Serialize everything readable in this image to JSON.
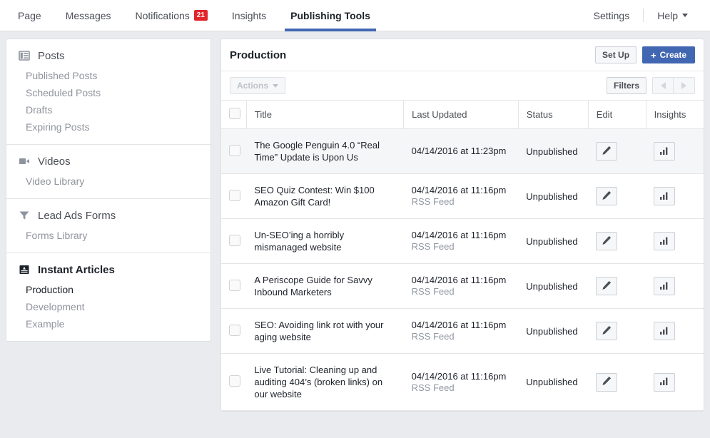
{
  "topnav": {
    "left_items": [
      {
        "label": "Page",
        "badge": null,
        "active": false
      },
      {
        "label": "Messages",
        "badge": null,
        "active": false
      },
      {
        "label": "Notifications",
        "badge": "21",
        "active": false
      },
      {
        "label": "Insights",
        "badge": null,
        "active": false
      },
      {
        "label": "Publishing Tools",
        "badge": null,
        "active": true
      }
    ],
    "right_items": [
      {
        "label": "Settings",
        "caret": false
      },
      {
        "label": "Help",
        "caret": true
      }
    ],
    "badge_color": "#e1252b",
    "active_underline_color": "#4267b2"
  },
  "sidebar": {
    "groups": [
      {
        "icon": "posts-icon",
        "title": "Posts",
        "current": false,
        "links": [
          {
            "label": "Published Posts",
            "current": false
          },
          {
            "label": "Scheduled Posts",
            "current": false
          },
          {
            "label": "Drafts",
            "current": false
          },
          {
            "label": "Expiring Posts",
            "current": false
          }
        ]
      },
      {
        "icon": "video-icon",
        "title": "Videos",
        "current": false,
        "links": [
          {
            "label": "Video Library",
            "current": false
          }
        ]
      },
      {
        "icon": "funnel-icon",
        "title": "Lead Ads Forms",
        "current": false,
        "links": [
          {
            "label": "Forms Library",
            "current": false
          }
        ]
      },
      {
        "icon": "instant-articles-icon",
        "title": "Instant Articles",
        "current": true,
        "links": [
          {
            "label": "Production",
            "current": true
          },
          {
            "label": "Development",
            "current": false
          },
          {
            "label": "Example",
            "current": false
          }
        ]
      }
    ]
  },
  "main": {
    "title": "Production",
    "setup_label": "Set Up",
    "create_label": "Create",
    "create_plus": "+",
    "actions_label": "Actions",
    "filters_label": "Filters",
    "create_button_color": "#4267b2",
    "columns": [
      "",
      "Title",
      "Last Updated",
      "Status",
      "Edit",
      "Insights"
    ],
    "rows": [
      {
        "title": "The Google Penguin 4.0 “Real Time” Update is Upon Us",
        "last_updated": "04/14/2016 at 11:23pm",
        "source": "",
        "status": "Unpublished",
        "edit_icon": "pencil-icon",
        "insights_icon": "bar-chart-icon",
        "highlighted": true
      },
      {
        "title": "SEO Quiz Contest: Win $100 Amazon Gift Card!",
        "last_updated": "04/14/2016 at 11:16pm",
        "source": "RSS Feed",
        "status": "Unpublished",
        "edit_icon": "pencil-icon",
        "insights_icon": "bar-chart-icon",
        "highlighted": false
      },
      {
        "title": "Un-SEO’ing a horribly mismanaged website",
        "last_updated": "04/14/2016 at 11:16pm",
        "source": "RSS Feed",
        "status": "Unpublished",
        "edit_icon": "pencil-icon",
        "insights_icon": "bar-chart-icon",
        "highlighted": false
      },
      {
        "title": "A Periscope Guide for Savvy Inbound Marketers",
        "last_updated": "04/14/2016 at 11:16pm",
        "source": "RSS Feed",
        "status": "Unpublished",
        "edit_icon": "pencil-icon",
        "insights_icon": "bar-chart-icon",
        "highlighted": false
      },
      {
        "title": "SEO: Avoiding link rot with your aging website",
        "last_updated": "04/14/2016 at 11:16pm",
        "source": "RSS Feed",
        "status": "Unpublished",
        "edit_icon": "pencil-icon",
        "insights_icon": "bar-chart-icon",
        "highlighted": false
      },
      {
        "title": "Live Tutorial: Cleaning up and auditing 404’s (broken links) on our website",
        "last_updated": "04/14/2016 at 11:16pm",
        "source": "RSS Feed",
        "status": "Unpublished",
        "edit_icon": "pencil-icon",
        "insights_icon": "bar-chart-icon",
        "highlighted": false
      }
    ]
  }
}
